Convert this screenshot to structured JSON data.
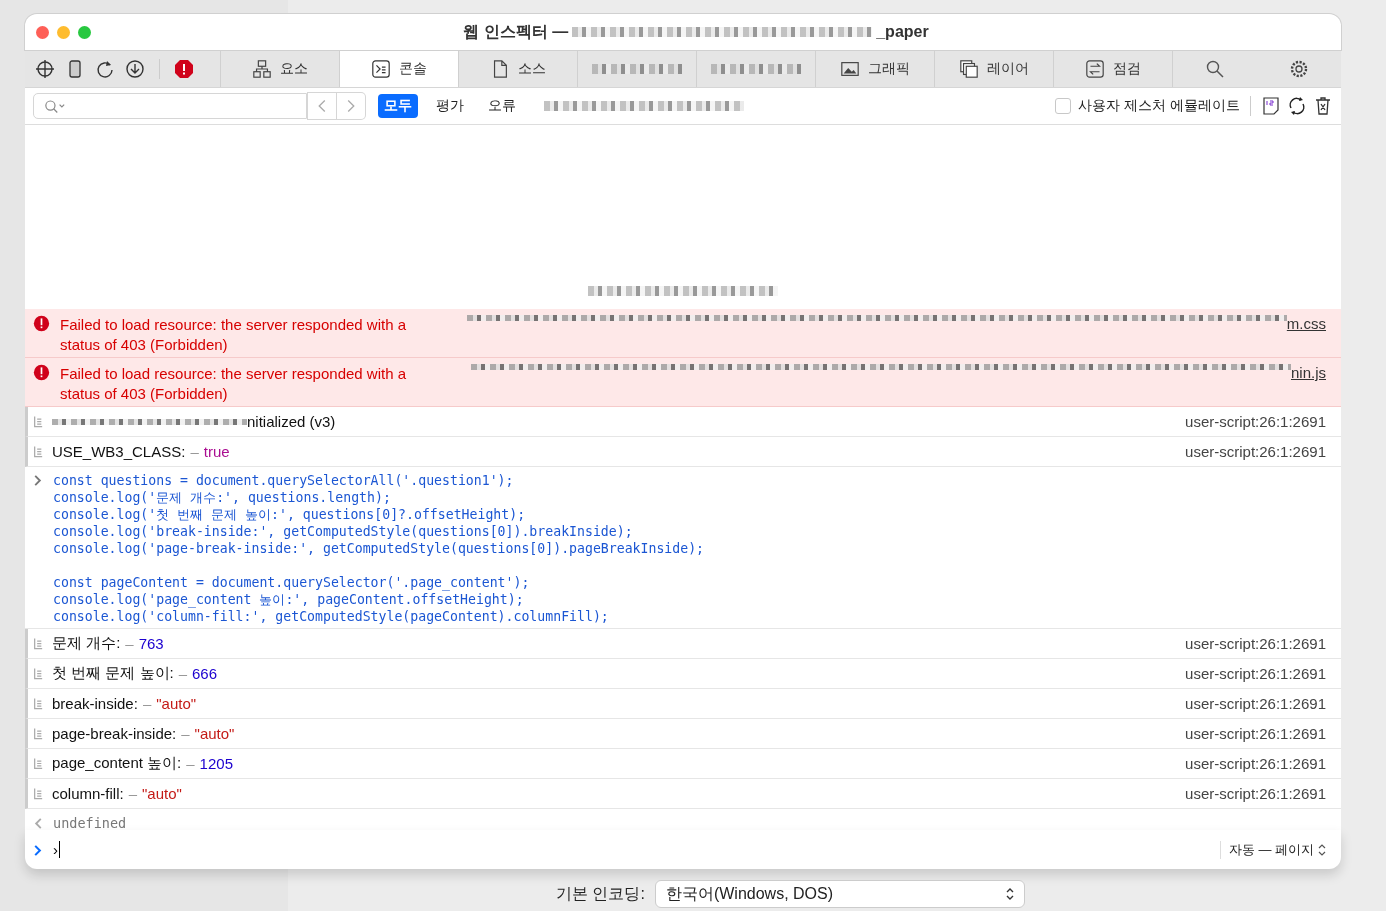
{
  "window": {
    "title_start": "웹 인스펙터 —",
    "title_end": "_paper"
  },
  "toolbar": {
    "tabs": [
      {
        "kind": "elements",
        "label": "요소",
        "selected": false
      },
      {
        "kind": "console",
        "label": "콘솔",
        "selected": true
      },
      {
        "kind": "sources",
        "label": "소스",
        "selected": false
      },
      {
        "kind": "redacted",
        "selected": false
      },
      {
        "kind": "redacted",
        "selected": false
      },
      {
        "kind": "graphics",
        "label": "그래픽",
        "selected": false
      },
      {
        "kind": "layers",
        "label": "레이어",
        "selected": false
      },
      {
        "kind": "audit",
        "label": "점검",
        "selected": false
      }
    ]
  },
  "filter_bar": {
    "filters": [
      {
        "label": "모두",
        "selected": true
      },
      {
        "label": "평가",
        "selected": false
      },
      {
        "label": "오류",
        "selected": false
      }
    ],
    "emulate_gesture": {
      "label": "사용자 제스처 에뮬레이트",
      "checked": false
    }
  },
  "messages": [
    {
      "kind": "error",
      "text": "Failed to load resource: the server responded with a status of 403 (Forbidden)",
      "source": "m.css"
    },
    {
      "kind": "error",
      "text": "Failed to load resource: the server responded with a status of 403 (Forbidden)",
      "source": "nin.js"
    },
    {
      "kind": "partial",
      "text": "nitialized (v3)",
      "source": "user-script:26:1:2691"
    },
    {
      "kind": "log",
      "label": "USE_WB3_CLASS:",
      "separator": "–",
      "value": "true",
      "color": "#aa0d91",
      "source": "user-script:26:1:2691"
    },
    {
      "kind": "input",
      "blocks": [
        [
          "const questions = document.querySelectorAll('.question1');",
          "console.log('문제 개수:', questions.length);",
          "console.log('첫 번째 문제 높이:', questions[0]?.offsetHeight);",
          "console.log('break-inside:', getComputedStyle(questions[0]).breakInside);",
          "console.log('page-break-inside:', getComputedStyle(questions[0]).pageBreakInside);"
        ],
        [
          "const pageContent = document.querySelector('.page_content');",
          "console.log('page_content 높이:', pageContent.offsetHeight);",
          "console.log('column-fill:', getComputedStyle(pageContent).columnFill);"
        ]
      ]
    },
    {
      "kind": "log",
      "label": "문제 개수:",
      "separator": "–",
      "value": "763",
      "color": "#1c00cf",
      "source": "user-script:26:1:2691"
    },
    {
      "kind": "log",
      "label": "첫 번째 문제 높이:",
      "separator": "–",
      "value": "666",
      "color": "#1c00cf",
      "source": "user-script:26:1:2691"
    },
    {
      "kind": "log",
      "label": "break-inside:",
      "separator": "–",
      "value": "\"auto\"",
      "color": "#c41a16",
      "source": "user-script:26:1:2691"
    },
    {
      "kind": "log",
      "label": "page-break-inside:",
      "separator": "–",
      "value": "\"auto\"",
      "color": "#c41a16",
      "source": "user-script:26:1:2691"
    },
    {
      "kind": "log",
      "label": "page_content 높이:",
      "separator": "–",
      "value": "1205",
      "color": "#1c00cf",
      "source": "user-script:26:1:2691"
    },
    {
      "kind": "log",
      "label": "column-fill:",
      "separator": "–",
      "value": "\"auto\"",
      "color": "#c41a16",
      "source": "user-script:26:1:2691"
    },
    {
      "kind": "result",
      "text": "undefined"
    }
  ],
  "prompt": {
    "value": "›",
    "mode": "자동 — 페이지"
  },
  "background": {
    "encoding_label": "기본 인코딩:",
    "encoding_value": "한국어(Windows, DOS)"
  }
}
